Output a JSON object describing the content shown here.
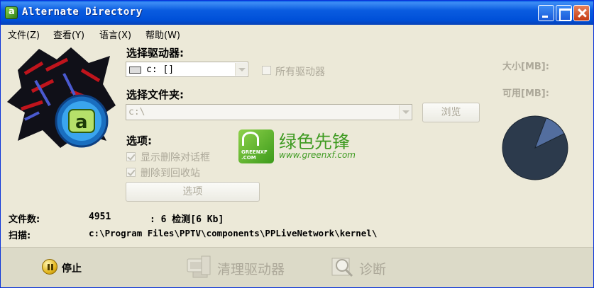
{
  "window": {
    "title": "Alternate Directory"
  },
  "menu": [
    {
      "label": "文件(Z)"
    },
    {
      "label": "查看(Y)"
    },
    {
      "label": "语言(X)"
    },
    {
      "label": "帮助(W)"
    }
  ],
  "drive": {
    "label": "选择驱动器:",
    "selected": "c: []",
    "all_drives_label": "所有驱动器",
    "all_drives_checked": false
  },
  "folder": {
    "label": "选择文件夹:",
    "value": "c:\\",
    "browse_label": "浏览"
  },
  "options": {
    "label": "选项:",
    "show_delete_dialog_label": "显示删除对话框",
    "show_delete_dialog_checked": true,
    "delete_to_recycle_label": "删除到回收站",
    "delete_to_recycle_checked": true,
    "button_label": "选项"
  },
  "stats": {
    "size_label": "大小[MB]:",
    "free_label": "可用[MB]:",
    "pie_fraction_free": 0.12,
    "pie_colors": {
      "used": "#2c3a4c",
      "free": "#536e9f"
    }
  },
  "watermark": {
    "badge_text": "GREENXF .COM",
    "title": "绿色先锋",
    "url": "www.greenxf.com"
  },
  "status": {
    "files_label": "文件数:",
    "files_value": "4951",
    "detect_text": ": 6 检测[6 Kb]",
    "scan_label": "扫描:",
    "scan_path": "c:\\Program Files\\PPTV\\components\\PPLiveNetwork\\kernel\\"
  },
  "actions": {
    "stop_label": "停止",
    "clean_label": "清理驱动器",
    "diagnose_label": "诊断"
  }
}
